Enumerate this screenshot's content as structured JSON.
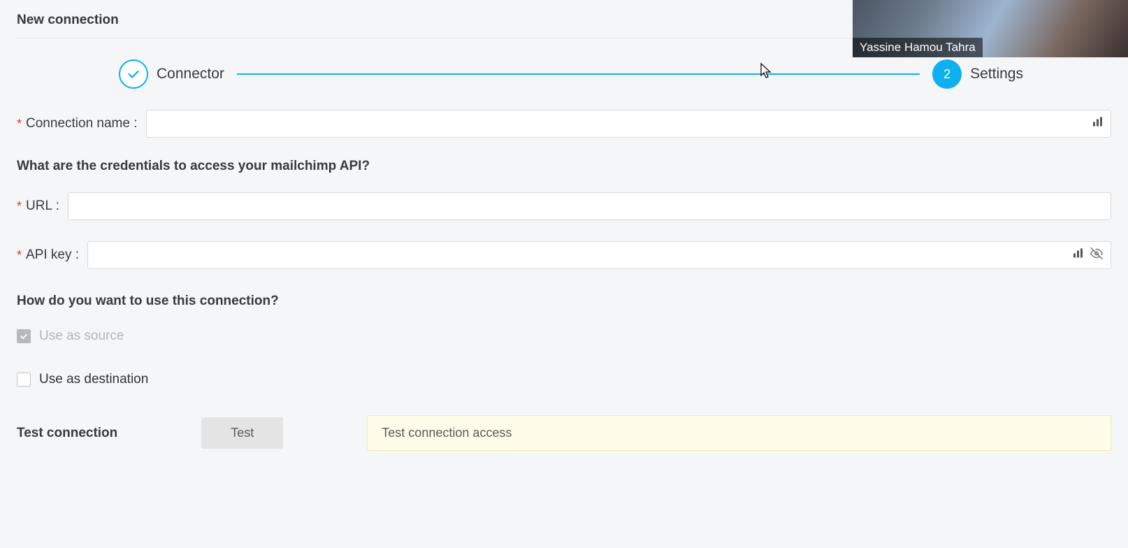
{
  "page": {
    "title": "New connection"
  },
  "stepper": {
    "step1": {
      "label": "Connector",
      "state": "done"
    },
    "step2": {
      "number": "2",
      "label": "Settings",
      "state": "active"
    }
  },
  "form": {
    "connection_name": {
      "label": "Connection name :",
      "value": ""
    },
    "credentials_heading": "What are the credentials to access your mailchimp API?",
    "url": {
      "label": "URL :",
      "value": ""
    },
    "api_key": {
      "label": "API key :",
      "value": ""
    },
    "usage_heading": "How do you want to use this connection?",
    "use_source": {
      "label": "Use as source",
      "checked": true,
      "disabled": true
    },
    "use_destination": {
      "label": "Use as destination",
      "checked": false
    }
  },
  "test": {
    "label": "Test connection",
    "button_label": "Test",
    "banner_text": "Test connection access"
  },
  "webcam": {
    "participant_name": "Yassine Hamou Tahra"
  }
}
